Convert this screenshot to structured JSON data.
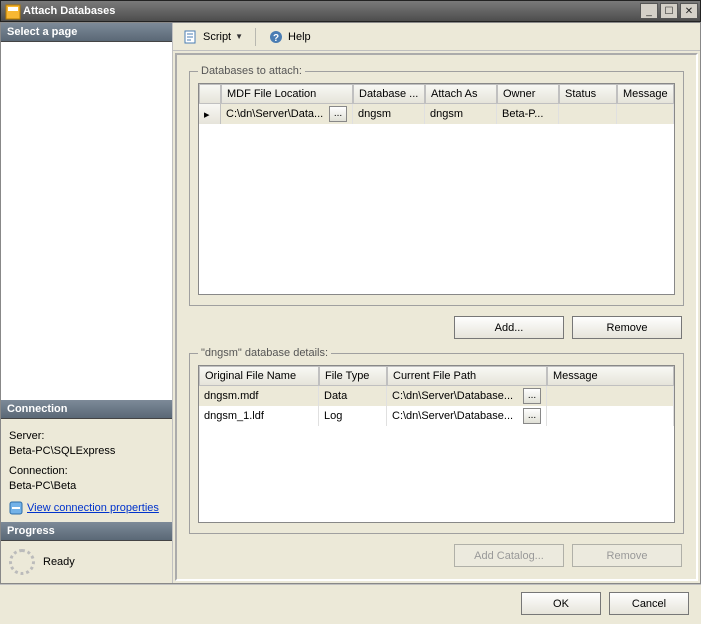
{
  "window": {
    "title": "Attach Databases"
  },
  "toolbar": {
    "script": "Script",
    "help": "Help"
  },
  "sidebar": {
    "selectPageHeader": "Select a page",
    "connectionHeader": "Connection",
    "serverLabel": "Server:",
    "serverValue": "Beta-PC\\SQLExpress",
    "connLabel": "Connection:",
    "connValue": "Beta-PC\\Beta",
    "viewConnLink": "View connection properties",
    "progressHeader": "Progress",
    "progressStatus": "Ready"
  },
  "main": {
    "attachLegend": "Databases to attach:",
    "detailsLegend": "\"dngsm\" database details:",
    "addBtn": "Add...",
    "removeBtn": "Remove",
    "addCatalogBtn": "Add Catalog...",
    "removeBtn2": "Remove",
    "grid1": {
      "headers": {
        "mdf": "MDF File Location",
        "db": "Database ...",
        "attachAs": "Attach As",
        "owner": "Owner",
        "status": "Status",
        "message": "Message"
      },
      "rows": [
        {
          "mdf": "C:\\dn\\Server\\Data...",
          "db": "dngsm",
          "attachAs": "dngsm",
          "owner": "Beta-P...",
          "status": "",
          "message": ""
        }
      ]
    },
    "grid2": {
      "headers": {
        "orig": "Original File Name",
        "ftype": "File Type",
        "path": "Current File Path",
        "message": "Message"
      },
      "rows": [
        {
          "orig": "dngsm.mdf",
          "ftype": "Data",
          "path": "C:\\dn\\Server\\Database...",
          "message": ""
        },
        {
          "orig": "dngsm_1.ldf",
          "ftype": "Log",
          "path": "C:\\dn\\Server\\Database...",
          "message": ""
        }
      ]
    }
  },
  "footer": {
    "ok": "OK",
    "cancel": "Cancel"
  }
}
